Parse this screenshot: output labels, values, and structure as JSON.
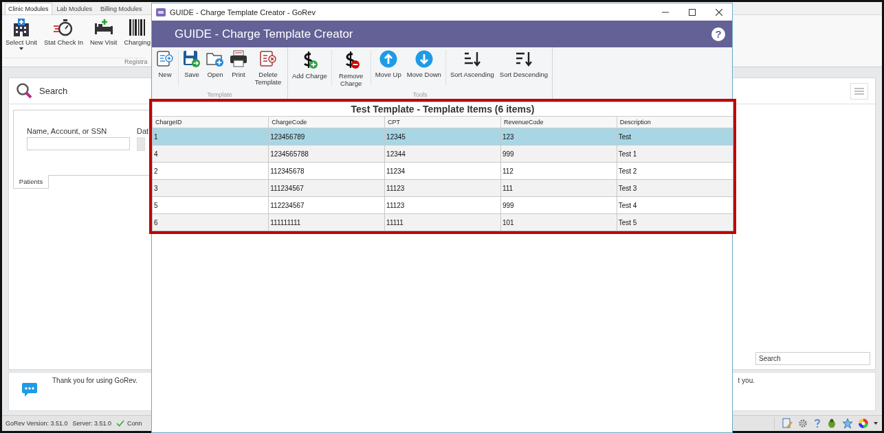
{
  "main_app": {
    "tabs": [
      {
        "label": "Clinic Modules",
        "selected": true
      },
      {
        "label": "Lab Modules",
        "selected": false
      },
      {
        "label": "Billing Modules",
        "selected": false
      }
    ],
    "ribbon": {
      "buttons": [
        {
          "label": "Select Unit",
          "kind": "hospital"
        },
        {
          "label": "Stat Check In",
          "kind": "stopwatch"
        },
        {
          "label": "New Visit",
          "kind": "bed"
        },
        {
          "label": "Charging",
          "kind": "barcode"
        }
      ],
      "group_label": "Registra"
    },
    "search_panel": {
      "title": "Search",
      "field_label": "Name, Account, or SSN",
      "field_label_2": "Dat",
      "tab": "Patients",
      "search_box": {
        "placeholder": "Search"
      }
    },
    "message": {
      "text": "Thank you for using GoRev.",
      "text_end": "t you."
    },
    "status_bar": {
      "version": "GoRev Version: 3.51.0",
      "server": "Server: 3.51.0",
      "connection": "Conn"
    }
  },
  "dialog": {
    "title": "GUIDE - Charge Template Creator - GoRev",
    "header": "GUIDE - Charge Template Creator",
    "help": "?",
    "groups": [
      {
        "label": "Template",
        "buttons": [
          {
            "label": "New",
            "kind": "new"
          },
          {
            "label": "Save",
            "kind": "save"
          },
          {
            "label": "Open",
            "kind": "open"
          },
          {
            "label": "Print",
            "kind": "print"
          },
          {
            "label": "Delete Template",
            "kind": "delete"
          }
        ]
      },
      {
        "label": "Tools",
        "buttons": [
          {
            "label": "Add Charge",
            "kind": "add-charge"
          },
          {
            "label": "Remove Charge",
            "kind": "remove-charge"
          },
          {
            "label": "Move Up",
            "kind": "move-up"
          },
          {
            "label": "Move Down",
            "kind": "move-down"
          },
          {
            "label": "Sort Ascending",
            "kind": "sort-ascending"
          },
          {
            "label": "Sort Descending",
            "kind": "sort-descending"
          }
        ]
      }
    ],
    "grid": {
      "title": "Test Template - Template Items (6 items)",
      "columns": [
        "ChargeID",
        "ChargeCode",
        "CPT",
        "RevenueCode",
        "Description"
      ],
      "rows": [
        {
          "cells": [
            "1",
            "123456789",
            "12345",
            "123",
            "Test"
          ],
          "selected": true
        },
        {
          "cells": [
            "4",
            "1234565788",
            "12344",
            "999",
            "Test 1"
          ],
          "selected": false
        },
        {
          "cells": [
            "2",
            "112345678",
            "11234",
            "112",
            "Test 2"
          ],
          "selected": false
        },
        {
          "cells": [
            "3",
            "111234567",
            "11123",
            "111",
            "Test 3"
          ],
          "selected": false
        },
        {
          "cells": [
            "5",
            "112234567",
            "11123",
            "999",
            "Test 4"
          ],
          "selected": false
        },
        {
          "cells": [
            "6",
            "111111111",
            "11111",
            "101",
            "Test 5"
          ],
          "selected": false
        }
      ]
    }
  }
}
